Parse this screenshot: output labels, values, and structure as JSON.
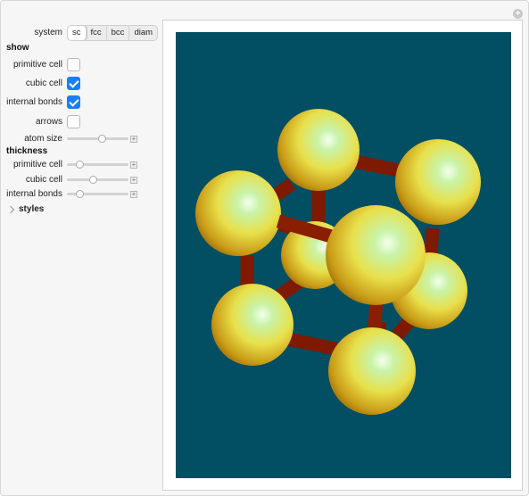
{
  "controls": {
    "system": {
      "label": "system",
      "options": [
        "sc",
        "fcc",
        "bcc",
        "diam"
      ],
      "selected": "sc"
    },
    "show": {
      "title": "show",
      "primitive_cell": {
        "label": "primitive cell",
        "checked": false
      },
      "cubic_cell": {
        "label": "cubic cell",
        "checked": true
      },
      "internal_bonds": {
        "label": "internal bonds",
        "checked": true
      },
      "arrows": {
        "label": "arrows",
        "checked": false
      },
      "atom_size": {
        "label": "atom size",
        "value": 0.58
      }
    },
    "thickness": {
      "title": "thickness",
      "primitive_cell": {
        "label": "primitive cell",
        "value": 0.17
      },
      "cubic_cell": {
        "label": "cubic cell",
        "value": 0.42
      },
      "internal_bonds": {
        "label": "internal bonds",
        "value": 0.17
      }
    },
    "styles": {
      "label": "styles"
    }
  },
  "colors": {
    "background": "#024e63",
    "atom": "#e8e04a",
    "bond": "#8a1e00",
    "checkbox_on": "#1a7ff5"
  },
  "icons": {
    "corner": "plus-circle-icon",
    "styles": "chevron-right-icon",
    "slider_expand": "plus-icon"
  }
}
